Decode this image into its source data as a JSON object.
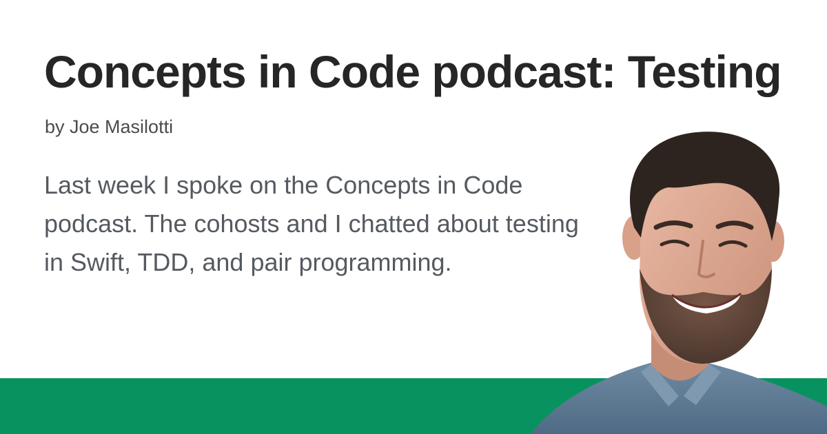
{
  "post": {
    "title": "Concepts in Code podcast: Testing",
    "author": "by Joe Masilotti",
    "excerpt": "Last week I spoke on the Concepts in Code podcast. The cohosts and I chatted about testing in Swift, TDD, and pair programming."
  },
  "theme": {
    "accent": "#08925f",
    "title_color": "#262626",
    "text_color": "#555a60",
    "background": "#ffffff"
  },
  "portrait": {
    "icon": "author-portrait-photo"
  }
}
